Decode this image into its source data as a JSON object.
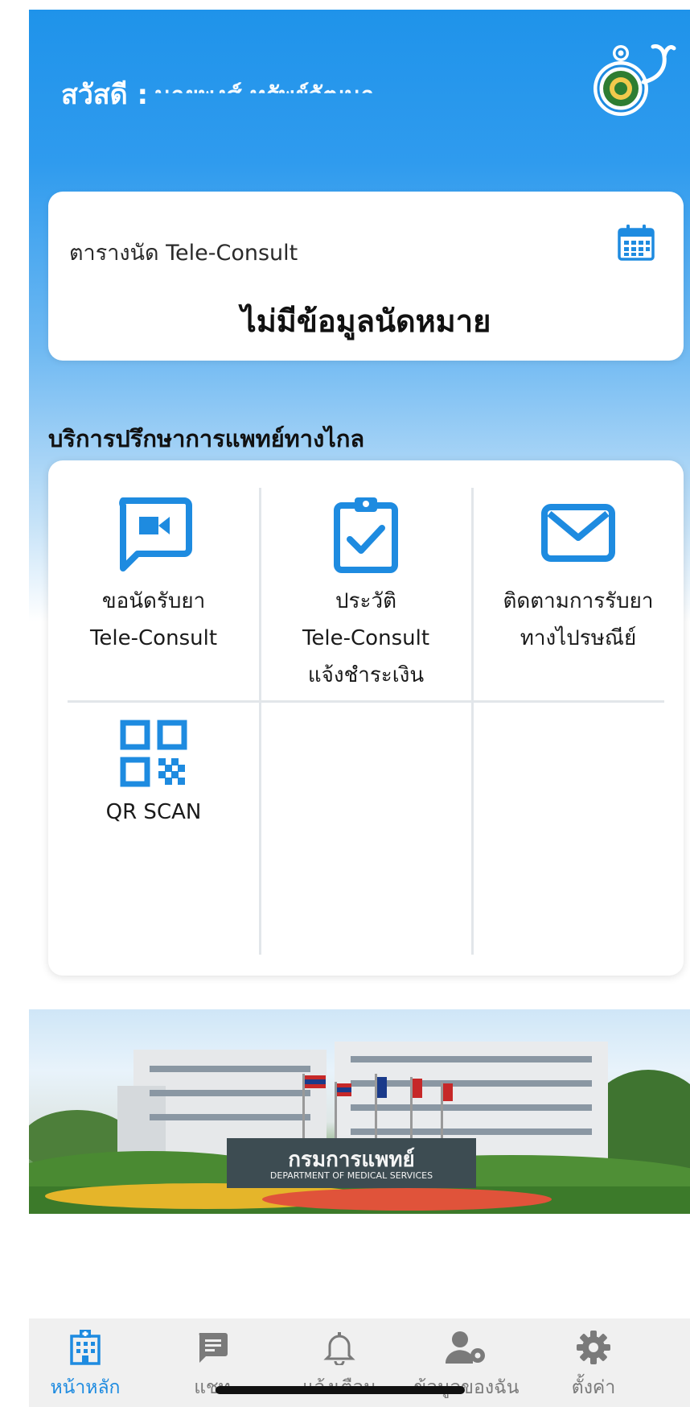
{
  "header": {
    "greeting": "สวัสดี :",
    "user_name": "นายพงศ์ ทรัพย์วัฒนา"
  },
  "appointment": {
    "title": "ตารางนัด Tele-Consult",
    "empty_message": "ไม่มีข้อมูลนัดหมาย"
  },
  "services": {
    "section_title": "บริการปรึกษาการแพทย์ทางไกล",
    "items": [
      {
        "icon": "video-chat-icon",
        "line1": "ขอนัดรับยา",
        "line2": "Tele-Consult",
        "line3": ""
      },
      {
        "icon": "clipboard-check-icon",
        "line1": "ประวัติ",
        "line2": "Tele-Consult",
        "line3": "แจ้งชำระเงิน"
      },
      {
        "icon": "mail-icon",
        "line1": "ติดตามการรับยา",
        "line2": "ทางไปรษณีย์",
        "line3": ""
      },
      {
        "icon": "qr-code-icon",
        "line1": "QR SCAN",
        "line2": "",
        "line3": ""
      }
    ]
  },
  "banner": {
    "sign_thai": "กรมการแพทย์",
    "sign_english": "DEPARTMENT OF MEDICAL SERVICES"
  },
  "tabs": [
    {
      "icon": "hospital-icon",
      "label": "หน้าหลัก",
      "active": true
    },
    {
      "icon": "chat-icon",
      "label": "แชท",
      "active": false
    },
    {
      "icon": "bell-icon",
      "label": "แจ้งเตือน",
      "active": false
    },
    {
      "icon": "user-settings-icon",
      "label": "ข้อมูลของฉัน",
      "active": false
    },
    {
      "icon": "gear-icon",
      "label": "ตั้งค่า",
      "active": false
    }
  ],
  "colors": {
    "primary": "#1e8be0",
    "inactive": "#7a7a7a"
  }
}
